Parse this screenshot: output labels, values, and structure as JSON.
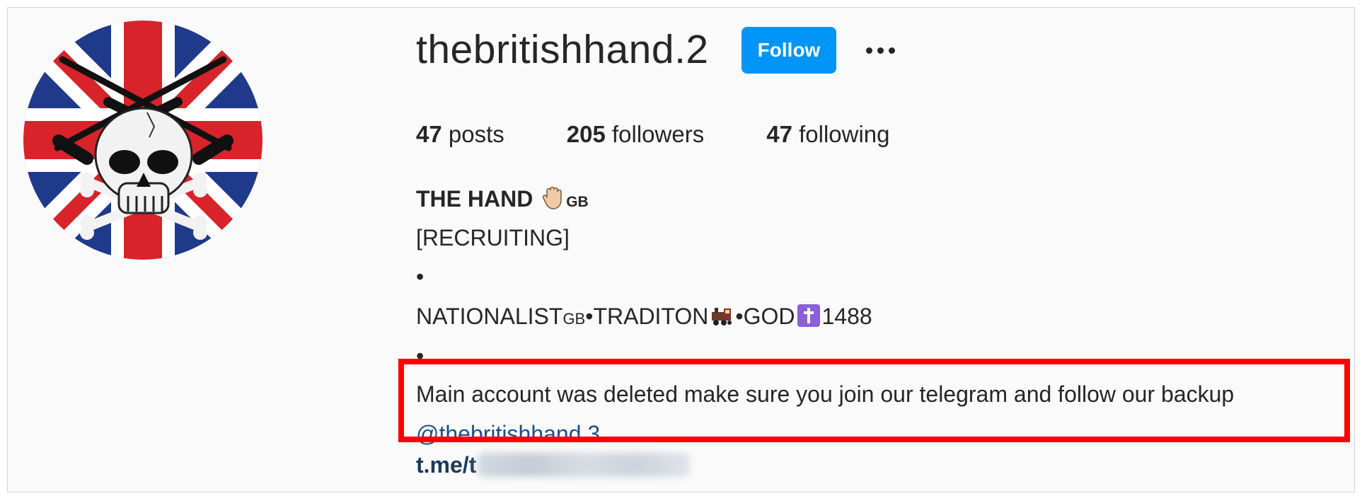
{
  "profile": {
    "username": "thebritishhand.2",
    "follow_label": "Follow",
    "more_icon": "more-horizontal-icon",
    "avatar_desc": "union-jack-skull-crossed-rifles-icon"
  },
  "stats": {
    "posts_count": "47",
    "posts_label": " posts",
    "followers_count": "205",
    "followers_label": " followers",
    "following_count": "47",
    "following_label": " following"
  },
  "bio": {
    "name": "THE HAND",
    "name_flag": "GB",
    "line_recruiting": "[RECRUITING]",
    "bullet": "•",
    "line_values_part1": "NATIONALIST",
    "line_values_flag": "GB",
    "line_values_part2": "•TRADITON",
    "line_values_part3": "•GOD",
    "line_values_part4": "1488",
    "highlighted_text": "Main account was deleted make sure you join our telegram and follow our backup",
    "mention": "@thebritishhand.3",
    "link_visible": "t.me/t"
  },
  "colors": {
    "follow_button": "#0095f6",
    "highlight_border": "#ff0000",
    "mention": "#1b4f8c"
  }
}
